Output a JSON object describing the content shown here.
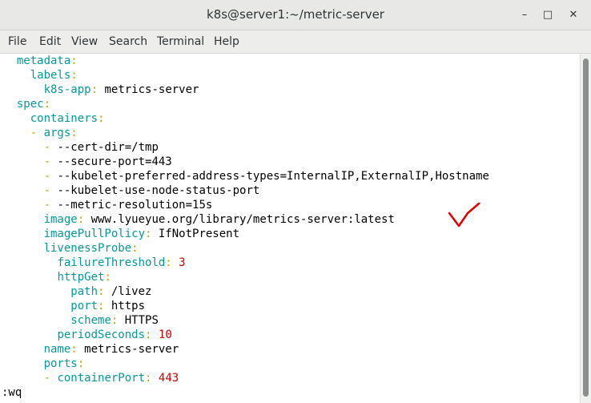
{
  "window": {
    "title": "k8s@server1:~/metric-server"
  },
  "controls": {
    "minimize": "–",
    "maximize": "□",
    "close": "✕"
  },
  "menu": [
    "File",
    "Edit",
    "View",
    "Search",
    "Terminal",
    "Help"
  ],
  "lines": [
    {
      "indent": "  ",
      "dash": "",
      "key": "metadata",
      "value": "",
      "num": ""
    },
    {
      "indent": "    ",
      "dash": "",
      "key": "labels",
      "value": "",
      "num": ""
    },
    {
      "indent": "      ",
      "dash": "",
      "key": "k8s-app",
      "value": " metrics-server",
      "num": ""
    },
    {
      "indent": "  ",
      "dash": "",
      "key": "spec",
      "value": "",
      "num": ""
    },
    {
      "indent": "    ",
      "dash": "",
      "key": "containers",
      "value": "",
      "num": ""
    },
    {
      "indent": "    ",
      "dash": "- ",
      "key": "args",
      "value": "",
      "num": ""
    },
    {
      "indent": "      ",
      "dash": "- ",
      "key": "",
      "value": "--cert-dir=/tmp",
      "num": ""
    },
    {
      "indent": "      ",
      "dash": "- ",
      "key": "",
      "value": "--secure-port=443",
      "num": ""
    },
    {
      "indent": "      ",
      "dash": "- ",
      "key": "",
      "value": "--kubelet-preferred-address-types=InternalIP,ExternalIP,Hostname",
      "num": ""
    },
    {
      "indent": "      ",
      "dash": "- ",
      "key": "",
      "value": "--kubelet-use-node-status-port",
      "num": ""
    },
    {
      "indent": "      ",
      "dash": "- ",
      "key": "",
      "value": "--metric-resolution=15s",
      "num": ""
    },
    {
      "indent": "      ",
      "dash": "",
      "key": "image",
      "value": " www.lyueyue.org/library/metrics-server:latest",
      "num": ""
    },
    {
      "indent": "      ",
      "dash": "",
      "key": "imagePullPolicy",
      "value": " IfNotPresent",
      "num": ""
    },
    {
      "indent": "      ",
      "dash": "",
      "key": "livenessProbe",
      "value": "",
      "num": ""
    },
    {
      "indent": "        ",
      "dash": "",
      "key": "failureThreshold",
      "value": "",
      "num": "3"
    },
    {
      "indent": "        ",
      "dash": "",
      "key": "httpGet",
      "value": "",
      "num": ""
    },
    {
      "indent": "          ",
      "dash": "",
      "key": "path",
      "value": " /livez",
      "num": ""
    },
    {
      "indent": "          ",
      "dash": "",
      "key": "port",
      "value": " https",
      "num": ""
    },
    {
      "indent": "          ",
      "dash": "",
      "key": "scheme",
      "value": " HTTPS",
      "num": ""
    },
    {
      "indent": "        ",
      "dash": "",
      "key": "periodSeconds",
      "value": "",
      "num": "10"
    },
    {
      "indent": "      ",
      "dash": "",
      "key": "name",
      "value": " metrics-server",
      "num": ""
    },
    {
      "indent": "      ",
      "dash": "",
      "key": "ports",
      "value": "",
      "num": ""
    },
    {
      "indent": "      ",
      "dash": "- ",
      "key": "containerPort",
      "value": "",
      "num": "443"
    }
  ],
  "status_line": ":wq",
  "colors": {
    "key": "#06989a",
    "dash": "#c4a000",
    "number": "#cc0000",
    "annotation": "#e30000"
  },
  "annotation_icon": "checkmark-icon"
}
